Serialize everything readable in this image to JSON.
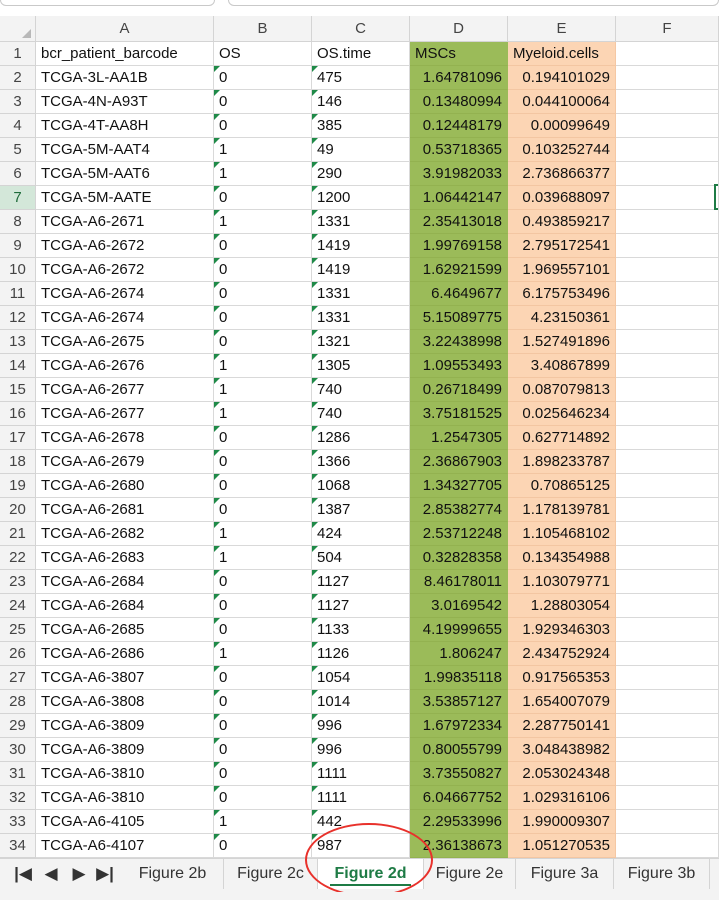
{
  "columns": [
    "A",
    "B",
    "C",
    "D",
    "E",
    "F"
  ],
  "rows": [
    {
      "n": "1",
      "a": "bcr_patient_barcode",
      "b": "OS",
      "c": "OS.time",
      "d": "MSCs",
      "e": "Myeloid.cells"
    },
    {
      "n": "2",
      "a": "TCGA-3L-AA1B",
      "b": "0",
      "c": "475",
      "d": "1.64781096",
      "e": "0.194101029"
    },
    {
      "n": "3",
      "a": "TCGA-4N-A93T",
      "b": "0",
      "c": "146",
      "d": "0.13480994",
      "e": "0.044100064"
    },
    {
      "n": "4",
      "a": "TCGA-4T-AA8H",
      "b": "0",
      "c": "385",
      "d": "0.12448179",
      "e": "0.00099649"
    },
    {
      "n": "5",
      "a": "TCGA-5M-AAT4",
      "b": "1",
      "c": "49",
      "d": "0.53718365",
      "e": "0.103252744"
    },
    {
      "n": "6",
      "a": "TCGA-5M-AAT6",
      "b": "1",
      "c": "290",
      "d": "3.91982033",
      "e": "2.736866377"
    },
    {
      "n": "7",
      "a": "TCGA-5M-AATE",
      "b": "0",
      "c": "1200",
      "d": "1.06442147",
      "e": "0.039688097"
    },
    {
      "n": "8",
      "a": "TCGA-A6-2671",
      "b": "1",
      "c": "1331",
      "d": "2.35413018",
      "e": "0.493859217"
    },
    {
      "n": "9",
      "a": "TCGA-A6-2672",
      "b": "0",
      "c": "1419",
      "d": "1.99769158",
      "e": "2.795172541"
    },
    {
      "n": "10",
      "a": "TCGA-A6-2672",
      "b": "0",
      "c": "1419",
      "d": "1.62921599",
      "e": "1.969557101"
    },
    {
      "n": "11",
      "a": "TCGA-A6-2674",
      "b": "0",
      "c": "1331",
      "d": "6.4649677",
      "e": "6.175753496"
    },
    {
      "n": "12",
      "a": "TCGA-A6-2674",
      "b": "0",
      "c": "1331",
      "d": "5.15089775",
      "e": "4.23150361"
    },
    {
      "n": "13",
      "a": "TCGA-A6-2675",
      "b": "0",
      "c": "1321",
      "d": "3.22438998",
      "e": "1.527491896"
    },
    {
      "n": "14",
      "a": "TCGA-A6-2676",
      "b": "1",
      "c": "1305",
      "d": "1.09553493",
      "e": "3.40867899"
    },
    {
      "n": "15",
      "a": "TCGA-A6-2677",
      "b": "1",
      "c": "740",
      "d": "0.26718499",
      "e": "0.087079813"
    },
    {
      "n": "16",
      "a": "TCGA-A6-2677",
      "b": "1",
      "c": "740",
      "d": "3.75181525",
      "e": "0.025646234"
    },
    {
      "n": "17",
      "a": "TCGA-A6-2678",
      "b": "0",
      "c": "1286",
      "d": "1.2547305",
      "e": "0.627714892"
    },
    {
      "n": "18",
      "a": "TCGA-A6-2679",
      "b": "0",
      "c": "1366",
      "d": "2.36867903",
      "e": "1.898233787"
    },
    {
      "n": "19",
      "a": "TCGA-A6-2680",
      "b": "0",
      "c": "1068",
      "d": "1.34327705",
      "e": "0.70865125"
    },
    {
      "n": "20",
      "a": "TCGA-A6-2681",
      "b": "0",
      "c": "1387",
      "d": "2.85382774",
      "e": "1.178139781"
    },
    {
      "n": "21",
      "a": "TCGA-A6-2682",
      "b": "1",
      "c": "424",
      "d": "2.53712248",
      "e": "1.105468102"
    },
    {
      "n": "22",
      "a": "TCGA-A6-2683",
      "b": "1",
      "c": "504",
      "d": "0.32828358",
      "e": "0.134354988"
    },
    {
      "n": "23",
      "a": "TCGA-A6-2684",
      "b": "0",
      "c": "1127",
      "d": "8.46178011",
      "e": "1.103079771"
    },
    {
      "n": "24",
      "a": "TCGA-A6-2684",
      "b": "0",
      "c": "1127",
      "d": "3.0169542",
      "e": "1.28803054"
    },
    {
      "n": "25",
      "a": "TCGA-A6-2685",
      "b": "0",
      "c": "1133",
      "d": "4.19999655",
      "e": "1.929346303"
    },
    {
      "n": "26",
      "a": "TCGA-A6-2686",
      "b": "1",
      "c": "1126",
      "d": "1.806247",
      "e": "2.434752924"
    },
    {
      "n": "27",
      "a": "TCGA-A6-3807",
      "b": "0",
      "c": "1054",
      "d": "1.99835118",
      "e": "0.917565353"
    },
    {
      "n": "28",
      "a": "TCGA-A6-3808",
      "b": "0",
      "c": "1014",
      "d": "3.53857127",
      "e": "1.654007079"
    },
    {
      "n": "29",
      "a": "TCGA-A6-3809",
      "b": "0",
      "c": "996",
      "d": "1.67972334",
      "e": "2.287750141"
    },
    {
      "n": "30",
      "a": "TCGA-A6-3809",
      "b": "0",
      "c": "996",
      "d": "0.80055799",
      "e": "3.048438982"
    },
    {
      "n": "31",
      "a": "TCGA-A6-3810",
      "b": "0",
      "c": "1111",
      "d": "3.73550827",
      "e": "2.053024348"
    },
    {
      "n": "32",
      "a": "TCGA-A6-3810",
      "b": "0",
      "c": "1111",
      "d": "6.04667752",
      "e": "1.029316106"
    },
    {
      "n": "33",
      "a": "TCGA-A6-4105",
      "b": "1",
      "c": "442",
      "d": "2.29533996",
      "e": "1.990009307"
    },
    {
      "n": "34",
      "a": "TCGA-A6-4107",
      "b": "0",
      "c": "987",
      "d": "2.36138673",
      "e": "1.051270535"
    }
  ],
  "selected_row": "7",
  "nav": {
    "first": "|◀",
    "prev": "◀",
    "next": "▶",
    "last": "▶|"
  },
  "sheet_tabs": [
    "Figure 2b",
    "Figure 2c",
    "Figure 2d",
    "Figure 2e",
    "Figure 3a",
    "Figure 3b"
  ],
  "active_tab": "Figure 2d",
  "colors": {
    "msc_fill": "#9bbb59",
    "myeloid_fill": "#fcd5b4",
    "accent": "#1e7b45",
    "annotation": "#e8312b"
  }
}
